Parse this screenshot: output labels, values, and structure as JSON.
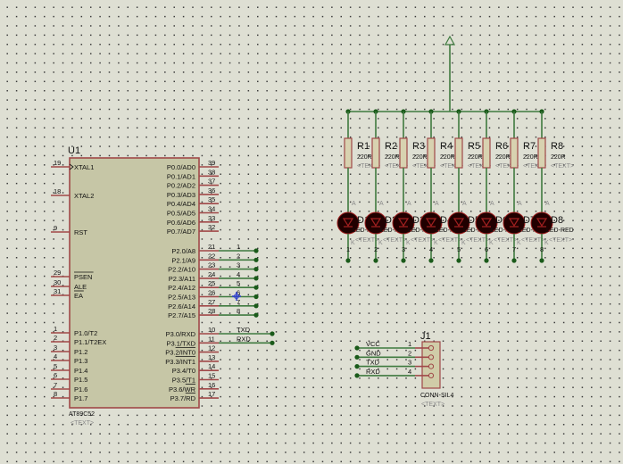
{
  "colors": {
    "wire": "#3f7a3f",
    "pin": "#a04848",
    "body": "#c6c6a6",
    "led": "#200000",
    "led_ring": "#a02020",
    "dot": "#1a5a1a",
    "probe": "#3040d0"
  },
  "u1": {
    "ref": "U1",
    "part": "AT89C52",
    "text": "<TEXT>",
    "left_pins": [
      {
        "n": "19",
        "l": "XTAL1"
      },
      {
        "n": "18",
        "l": "XTAL2"
      },
      {
        "n": "9",
        "l": "RST"
      },
      {
        "n": "29",
        "l": "PSEN",
        "bar": true
      },
      {
        "n": "30",
        "l": "ALE"
      },
      {
        "n": "31",
        "l": "EA",
        "bar": true
      },
      {
        "n": "1",
        "l": "P1.0/T2"
      },
      {
        "n": "2",
        "l": "P1.1/T2EX"
      },
      {
        "n": "3",
        "l": "P1.2"
      },
      {
        "n": "4",
        "l": "P1.3"
      },
      {
        "n": "5",
        "l": "P1.4"
      },
      {
        "n": "6",
        "l": "P1.5"
      },
      {
        "n": "7",
        "l": "P1.6"
      },
      {
        "n": "8",
        "l": "P1.7"
      }
    ],
    "p0_pins": [
      {
        "n": "39",
        "l": "P0.0/AD0"
      },
      {
        "n": "38",
        "l": "P0.1/AD1"
      },
      {
        "n": "37",
        "l": "P0.2/AD2"
      },
      {
        "n": "36",
        "l": "P0.3/AD3"
      },
      {
        "n": "35",
        "l": "P0.4/AD4"
      },
      {
        "n": "34",
        "l": "P0.5/AD5"
      },
      {
        "n": "33",
        "l": "P0.6/AD6"
      },
      {
        "n": "32",
        "l": "P0.7/AD7"
      }
    ],
    "p2_pins": [
      {
        "n": "21",
        "l": "P2.0/A8",
        "net": "1"
      },
      {
        "n": "22",
        "l": "P2.1/A9",
        "net": "2"
      },
      {
        "n": "23",
        "l": "P2.2/A10",
        "net": "3"
      },
      {
        "n": "24",
        "l": "P2.3/A11",
        "net": "4"
      },
      {
        "n": "25",
        "l": "P2.4/A12",
        "net": "5"
      },
      {
        "n": "26",
        "l": "P2.5/A13",
        "net": "6"
      },
      {
        "n": "27",
        "l": "P2.6/A14",
        "net": "7"
      },
      {
        "n": "28",
        "l": "P2.7/A15",
        "net": "8"
      }
    ],
    "p3_pins": [
      {
        "n": "10",
        "l": "P3.0/RXD",
        "net": "TXD"
      },
      {
        "n": "11",
        "l": "P3.1/TXD",
        "net": "RXD"
      },
      {
        "n": "12",
        "l": "P3.2/INT0"
      },
      {
        "n": "13",
        "l": "P3.3/INT1"
      },
      {
        "n": "14",
        "l": "P3.4/T0"
      },
      {
        "n": "15",
        "l": "P3.5/T1"
      },
      {
        "n": "16",
        "l": "P3.6/WR"
      },
      {
        "n": "17",
        "l": "P3.7/RD"
      }
    ]
  },
  "resistors": [
    {
      "ref": "R1",
      "val": "220R"
    },
    {
      "ref": "R2",
      "val": "220R"
    },
    {
      "ref": "R3",
      "val": "220R"
    },
    {
      "ref": "R4",
      "val": "220R"
    },
    {
      "ref": "R5",
      "val": "220R"
    },
    {
      "ref": "R6",
      "val": "220R"
    },
    {
      "ref": "R7",
      "val": "220R"
    },
    {
      "ref": "R8",
      "val": "220R"
    }
  ],
  "leds": [
    {
      "ref": "D1",
      "net": "1"
    },
    {
      "ref": "D2",
      "net": "2"
    },
    {
      "ref": "D3",
      "net": "3"
    },
    {
      "ref": "D4",
      "net": "4"
    },
    {
      "ref": "D5",
      "net": "5"
    },
    {
      "ref": "D6",
      "net": "6"
    },
    {
      "ref": "D7",
      "net": "7"
    },
    {
      "ref": "D8",
      "net": "8"
    }
  ],
  "led_value": "LED-RED",
  "text_placeholder": "<TEXT>",
  "anode_mark": "A",
  "cathode_mark": "K",
  "j1": {
    "ref": "J1",
    "part": "CONN-SIL4",
    "text": "<TEXT>",
    "pins": [
      {
        "n": "1",
        "net": "VCC"
      },
      {
        "n": "2",
        "net": "GND"
      },
      {
        "n": "3",
        "net": "TXD"
      },
      {
        "n": "4",
        "net": "RXD"
      }
    ]
  }
}
